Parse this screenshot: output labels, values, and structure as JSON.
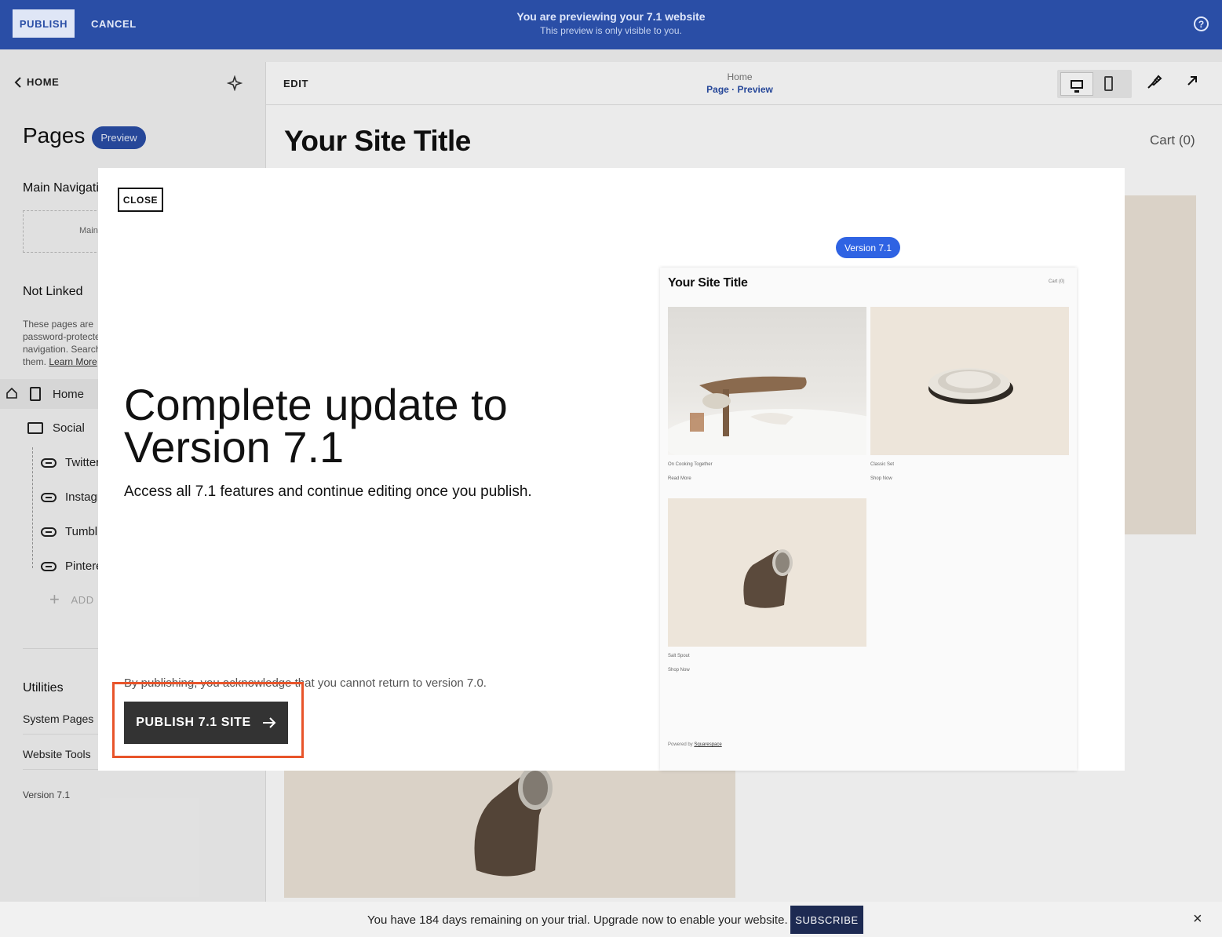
{
  "topbar": {
    "publish_label": "PUBLISH",
    "cancel_label": "CANCEL",
    "title": "You are previewing your 7.1 website",
    "subtitle": "This preview is only visible to you.",
    "help_icon": "?"
  },
  "sidebar": {
    "back_label": "HOME",
    "pages_title": "Pages",
    "preview_badge": "Preview",
    "main_navigation": "Main Navigation",
    "main_box_text": "Main",
    "not_linked_title": "Not Linked",
    "not_linked_desc_lines": [
      "These pages are",
      "password-protected",
      "navigation. Search",
      "them."
    ],
    "learn_more": "Learn More",
    "home_item": "Home",
    "social_folder": "Social",
    "links": [
      "Twitter",
      "Instagram",
      "Tumblr",
      "Pinterest"
    ],
    "add_label": "ADD",
    "utilities_title": "Utilities",
    "system_pages": "System Pages",
    "website_tools": "Website Tools",
    "version": "Version 7.1"
  },
  "preview": {
    "edit_label": "EDIT",
    "crumb_top": "Home",
    "crumb_bottom": "Page · Preview",
    "site_title": "Your Site Title",
    "cart": "Cart (0)"
  },
  "modal": {
    "close_label": "CLOSE",
    "heading": "Complete update to Version 7.1",
    "subheading": "Access all 7.1 features and continue editing once you publish.",
    "disclaimer": "By publishing, you acknowledge that you cannot return to version 7.0.",
    "cta_label": "PUBLISH 7.1 SITE",
    "version_pill": "Version 7.1",
    "mini_site": {
      "title": "Your Site Title",
      "cart": "Cart (0)",
      "items": [
        {
          "caption": "On Cooking Together",
          "link": "Read More"
        },
        {
          "caption": "Classic Set",
          "link": "Shop Now"
        },
        {
          "caption": "Salt Spout",
          "link": "Shop Now"
        }
      ],
      "footer_prefix": "Powered by",
      "footer_link": "Squarespace"
    }
  },
  "banner": {
    "trial_text": "You have 184 days remaining on your trial. Upgrade now to enable your website.",
    "subscribe_label": "SUBSCRIBE",
    "close_icon": "×"
  },
  "colors": {
    "topbar": "#2a4ea6",
    "highlight": "#e8542a",
    "version_pill": "#2f63e3",
    "subscribe": "#1d2a52"
  }
}
